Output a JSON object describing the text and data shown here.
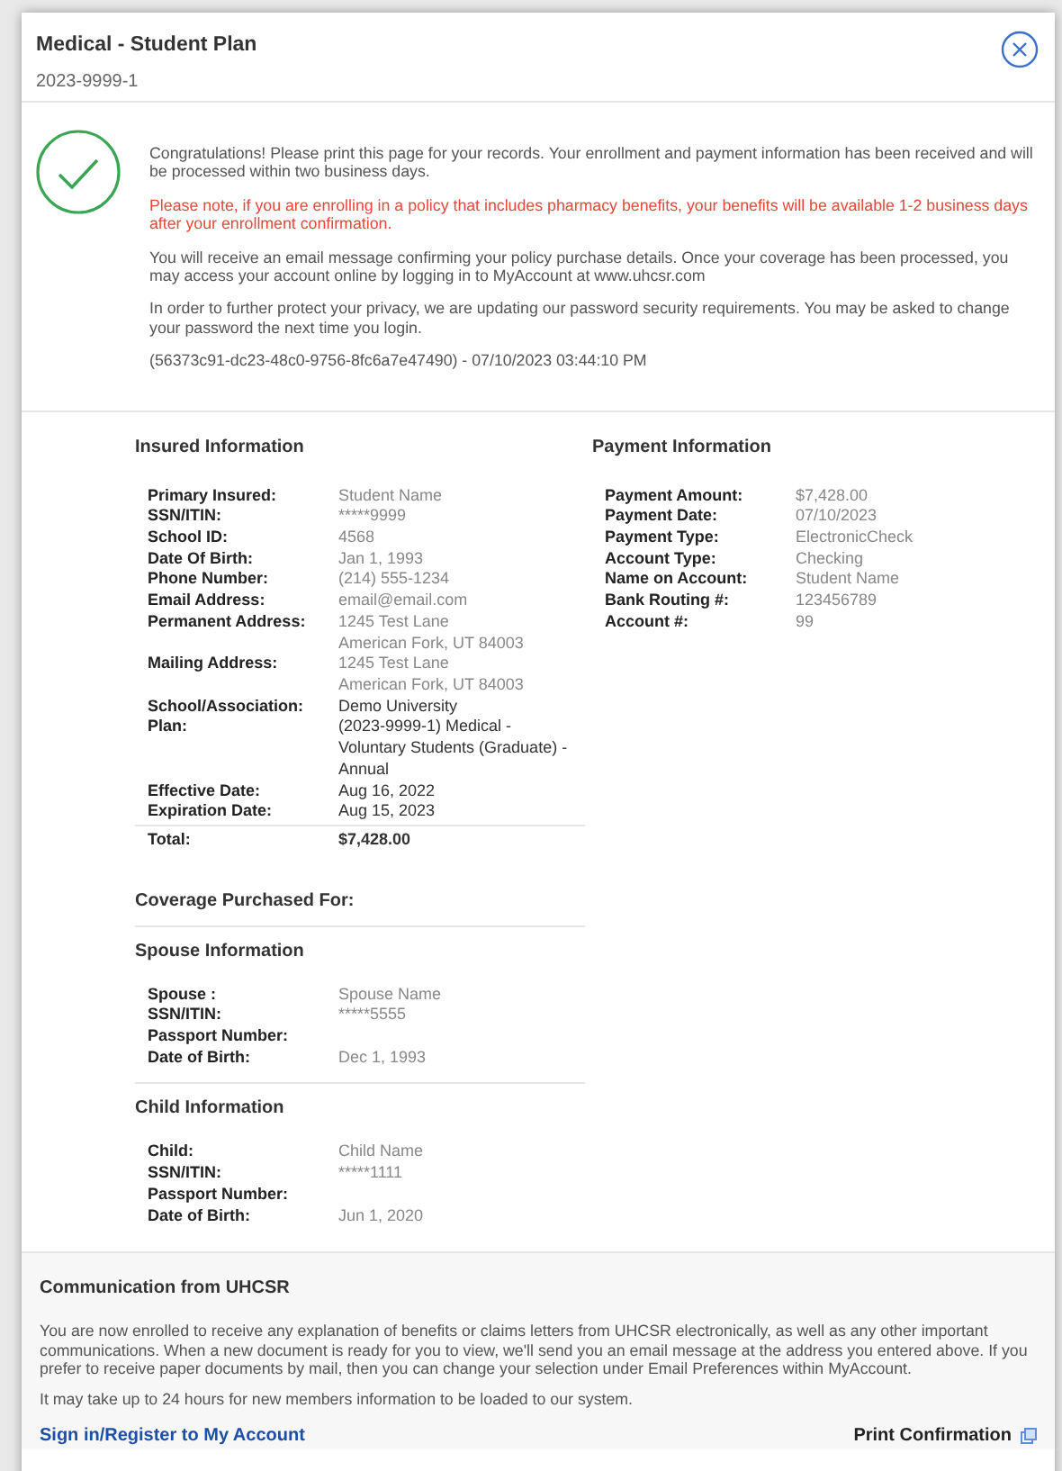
{
  "modal": {
    "title": "Medical - Student Plan",
    "subtitle": "2023-9999-1"
  },
  "confirmation": {
    "paragraphs": [
      {
        "kind": "normal",
        "text": "Congratulations! Please print this page for your records. Your enrollment and payment information has been received and will be processed within two business days."
      },
      {
        "kind": "warning",
        "text": "Please note, if you are enrolling in a policy that includes pharmacy benefits, your benefits will be available 1-2 business days after your enrollment confirmation."
      },
      {
        "kind": "normal",
        "text": "You will receive an email message confirming your policy purchase details. Once your coverage has been processed, you may access your account online by logging in to MyAccount at www.uhcsr.com"
      },
      {
        "kind": "normal",
        "text": "In order to further protect your privacy, we are updating our password security requirements. You may be asked to change your password the next time you login."
      },
      {
        "kind": "normal",
        "text": "(56373c91-dc23-48c0-9756-8fc6a7e47490) - 07/10/2023 03:44:10 PM"
      }
    ]
  },
  "insured": {
    "heading": "Insured Information",
    "rows": [
      {
        "label": "Primary Insured:",
        "dark": false,
        "lines": [
          "Student Name"
        ]
      },
      {
        "label": "SSN/ITIN:",
        "dark": false,
        "lines": [
          "*****9999"
        ]
      },
      {
        "label": "School ID:",
        "dark": false,
        "lines": [
          "4568"
        ]
      },
      {
        "label": "Date Of Birth:",
        "dark": false,
        "lines": [
          "Jan 1, 1993"
        ]
      },
      {
        "label": "Phone Number:",
        "dark": false,
        "lines": [
          "(214) 555-1234"
        ]
      },
      {
        "label": "Email Address:",
        "dark": false,
        "lines": [
          "email@email.com"
        ]
      },
      {
        "label": "Permanent Address:",
        "dark": false,
        "lines": [
          "1245 Test Lane",
          "American Fork, UT 84003"
        ]
      },
      {
        "label": "Mailing Address:",
        "dark": false,
        "lines": [
          "1245 Test Lane",
          "American Fork, UT 84003"
        ]
      },
      {
        "label": "School/Association:",
        "dark": true,
        "lines": [
          "Demo University"
        ]
      },
      {
        "label": "Plan:",
        "dark": true,
        "lines": [
          "(2023-9999-1) Medical -",
          "Voluntary Students (Graduate) -",
          "Annual"
        ]
      },
      {
        "label": "Effective Date:",
        "dark": true,
        "lines": [
          "Aug 16, 2022"
        ]
      },
      {
        "label": "Expiration Date:",
        "dark": true,
        "lines": [
          "Aug 15, 2023"
        ]
      }
    ],
    "total_label": "Total:",
    "total_value": "$7,428.00"
  },
  "payment": {
    "heading": "Payment Information",
    "rows": [
      {
        "label": "Payment Amount:",
        "value": "$7,428.00"
      },
      {
        "label": "Payment Date:",
        "value": "07/10/2023"
      },
      {
        "label": "Payment Type:",
        "value": "ElectronicCheck"
      },
      {
        "label": "Account Type:",
        "value": "Checking"
      },
      {
        "label": "Name on Account:",
        "value": "Student Name"
      },
      {
        "label": "Bank Routing #:",
        "value": "123456789"
      },
      {
        "label": "Account #:",
        "value": "99"
      }
    ]
  },
  "coverage": {
    "heading": "Coverage Purchased For:",
    "dependents": [
      {
        "heading": "Spouse  Information",
        "rows": [
          {
            "label": "Spouse :",
            "value": "Spouse Name"
          },
          {
            "label": "SSN/ITIN:",
            "value": "*****5555"
          },
          {
            "label": "Passport Number:",
            "value": ""
          },
          {
            "label": "Date of Birth:",
            "value": "Dec 1, 1993"
          }
        ]
      },
      {
        "heading": "Child Information",
        "rows": [
          {
            "label": "Child:",
            "value": "Child Name"
          },
          {
            "label": "SSN/ITIN:",
            "value": "*****1111"
          },
          {
            "label": "Passport Number:",
            "value": ""
          },
          {
            "label": "Date of Birth:",
            "value": "Jun 1, 2020"
          }
        ]
      }
    ]
  },
  "communication": {
    "heading": "Communication from UHCSR",
    "paragraphs": [
      "You are now enrolled to receive any explanation of benefits or claims letters from UHCSR electronically, as well as any other important communications. When a new document is ready for you to view, we'll send you an email message at the address you entered above. If you prefer to receive paper documents by mail, then you can change your selection under Email Preferences within MyAccount.",
      "It may take up to 24 hours for new members information to be loaded to our system."
    ],
    "sign_in_link": "Sign in/Register to My Account",
    "print_link": "Print Confirmation"
  }
}
